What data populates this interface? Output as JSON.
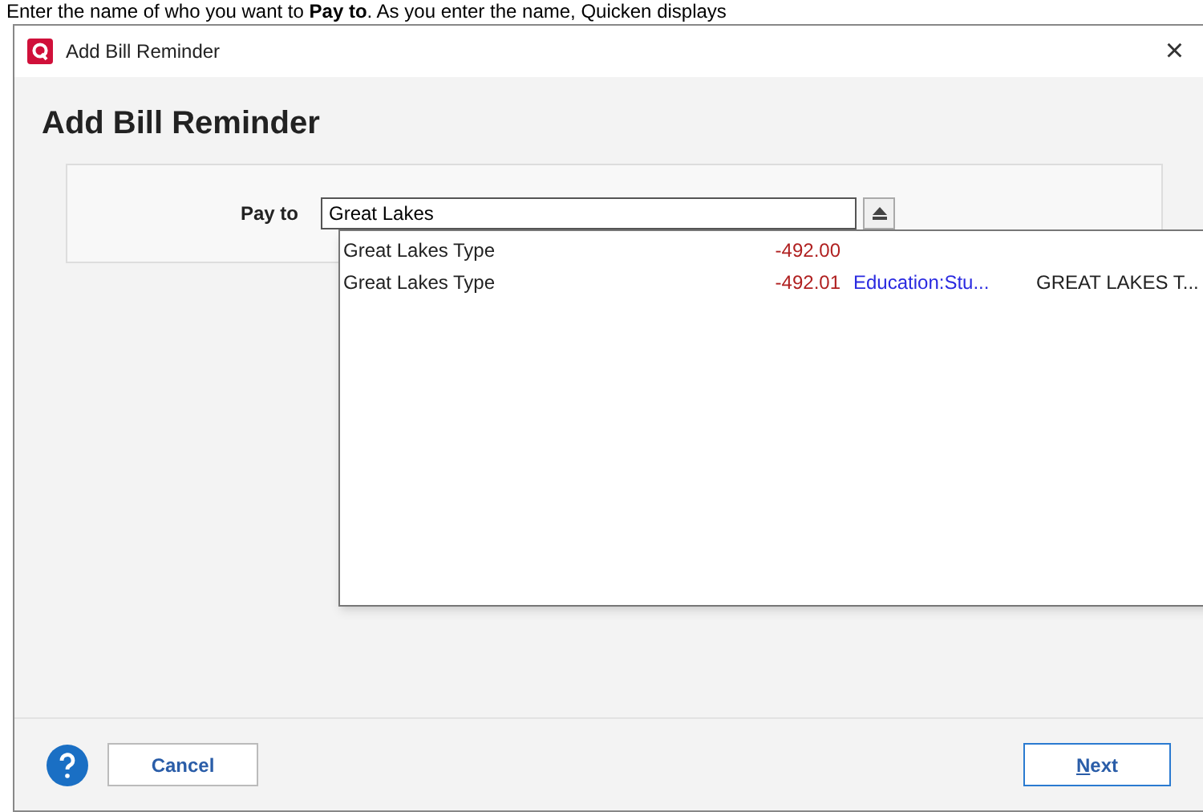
{
  "caption": "Enter the name of who you want to **Pay to**. As you enter the name, Quicken displays",
  "window": {
    "title": "Add Bill Reminder",
    "close": "×"
  },
  "heading": "Add Bill Reminder",
  "pay_to": {
    "label": "Pay to",
    "value": "Great Lakes"
  },
  "suggestions": [
    {
      "name": "Great Lakes Type",
      "amount": "-492.00"
    },
    {
      "name": "Great Lakes Type",
      "amount": "-492.01",
      "category": "Education:Stu...",
      "memo": "GREAT LAKES T..."
    }
  ],
  "buttons": {
    "cancel": "Cancel",
    "next": "Next"
  }
}
